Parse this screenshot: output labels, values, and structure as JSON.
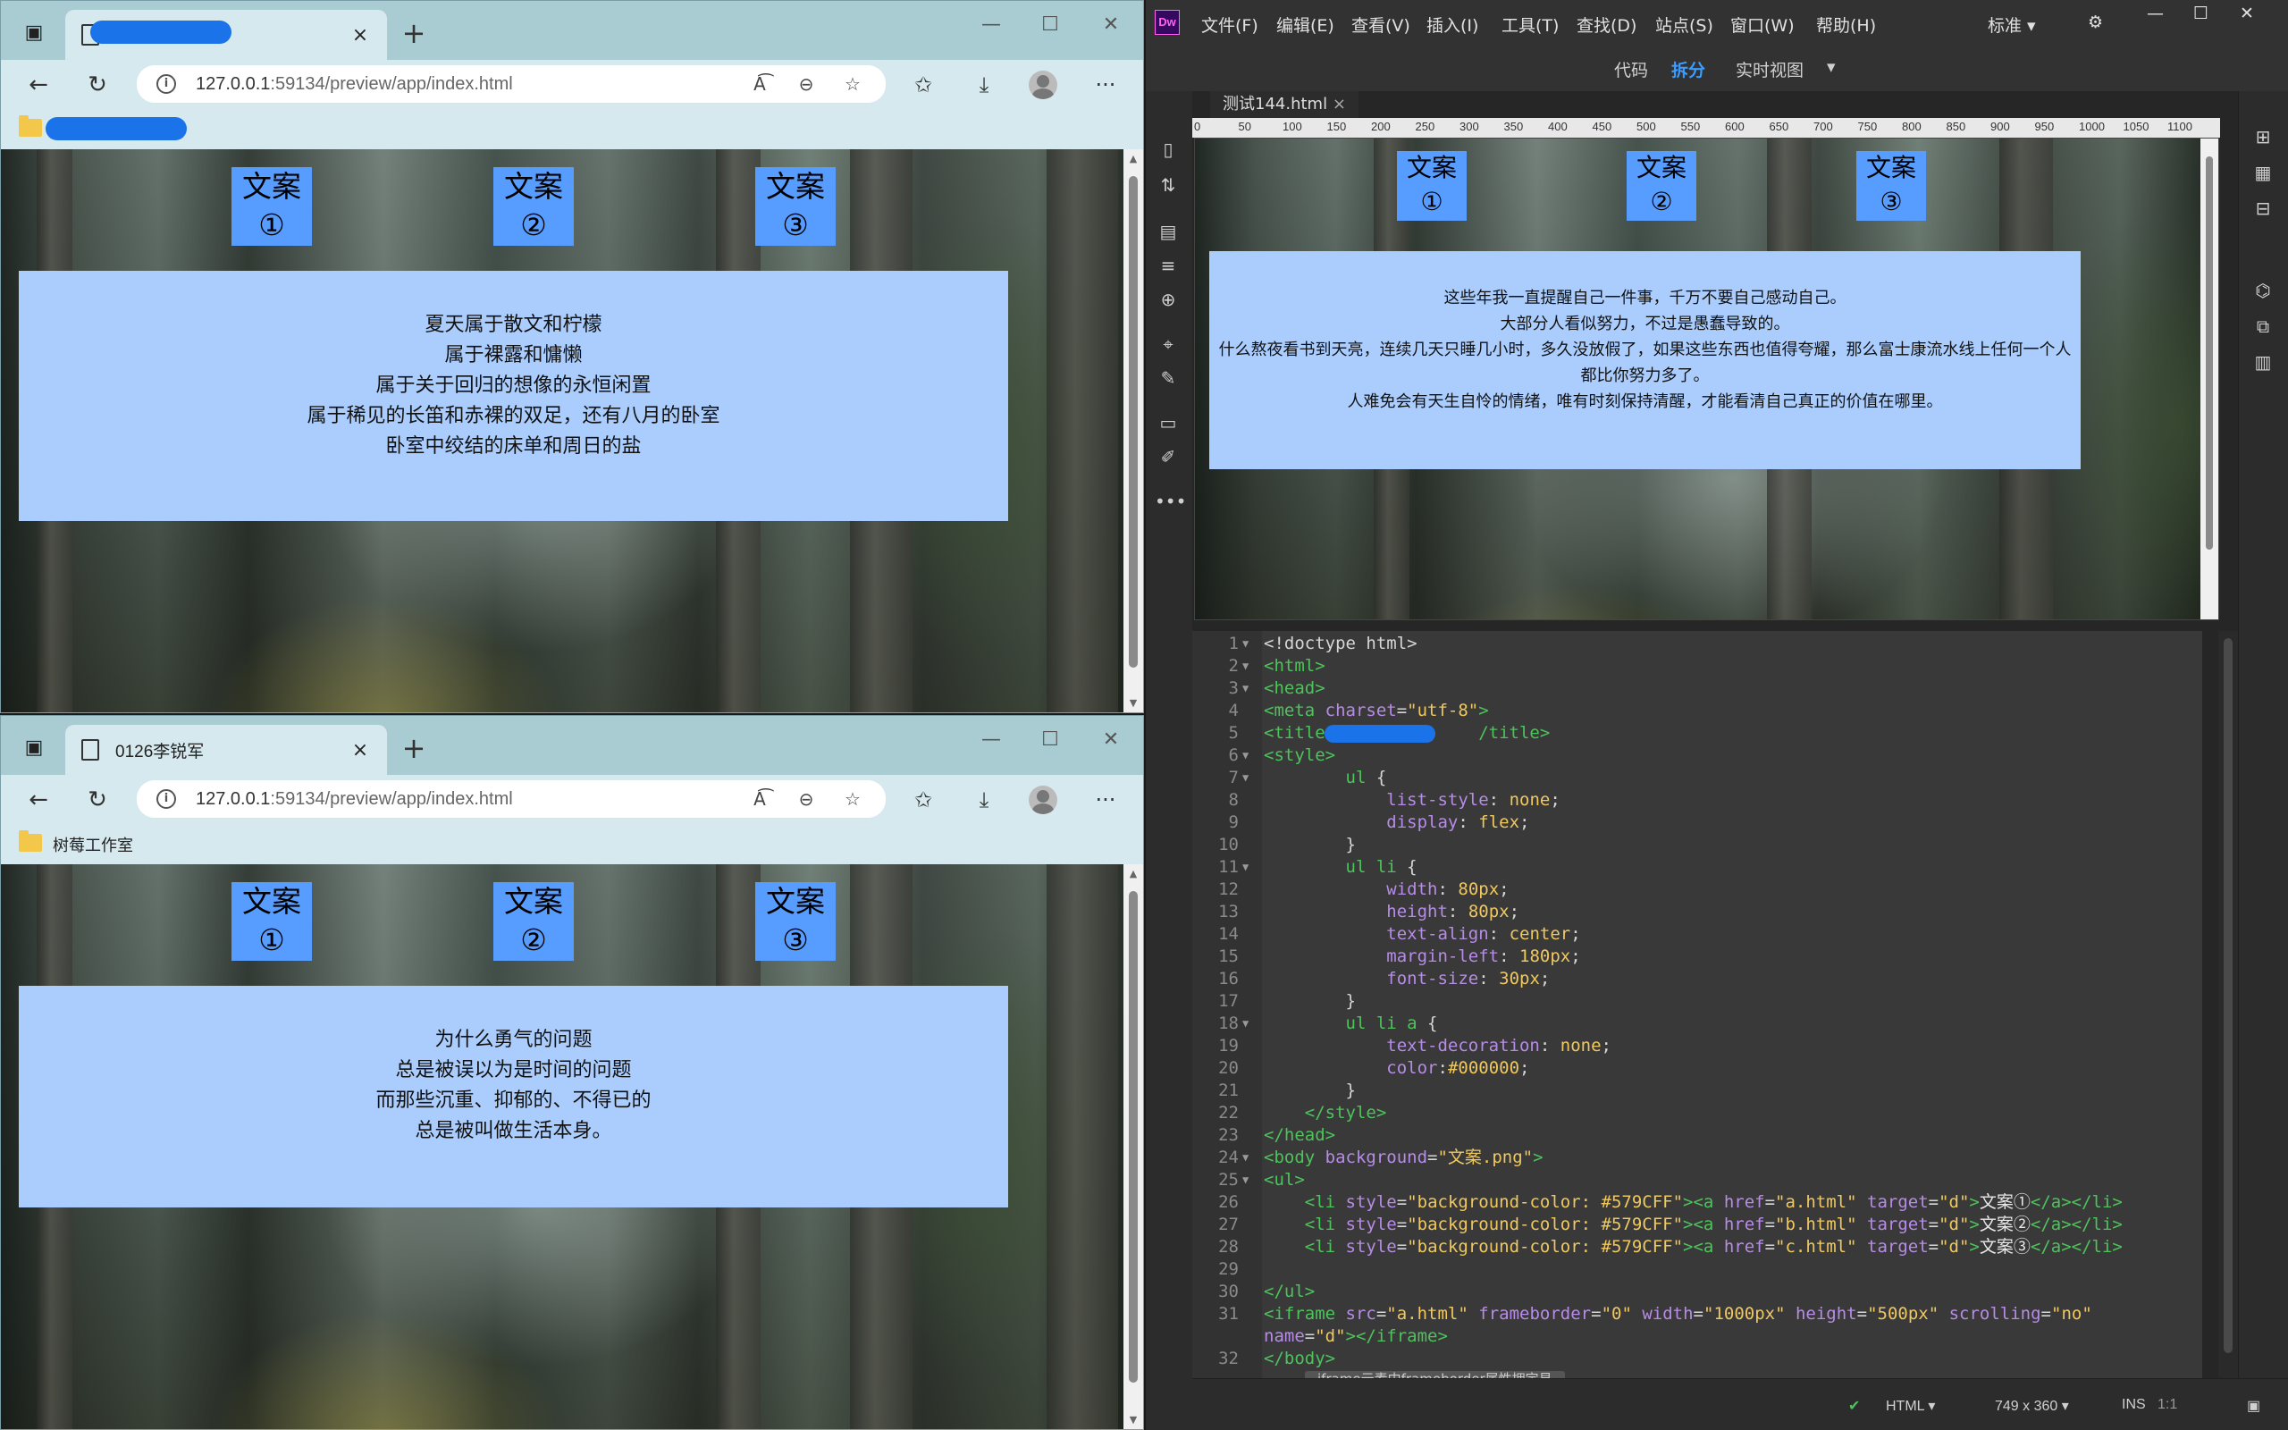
{
  "browser_top": {
    "tab_title": "",
    "url_host": "127.0.0.1",
    "url_path": ":59134/preview/app/index.html",
    "fav_label": "",
    "nav": [
      "文案①",
      "文案②",
      "文案③"
    ],
    "frame_lines": [
      "夏天属于散文和柠檬",
      "属于裸露和慵懒",
      "属于关于回归的想像的永恒闲置",
      "属于稀见的长笛和赤裸的双足，还有八月的卧室",
      "卧室中绞结的床单和周日的盐"
    ]
  },
  "browser_bottom": {
    "tab_title": "0126李锐军",
    "url_host": "127.0.0.1",
    "url_path": ":59134/preview/app/index.html",
    "fav_label": "树莓工作室",
    "nav": [
      "文案①",
      "文案②",
      "文案③"
    ],
    "frame_lines": [
      "为什么勇气的问题",
      "总是被误以为是时间的问题",
      "而那些沉重、抑郁的、不得已的",
      "总是被叫做生活本身。"
    ]
  },
  "dreamweaver": {
    "logo": "Dw",
    "menus": [
      "文件(F)",
      "编辑(E)",
      "查看(V)",
      "插入(I)",
      "工具(T)",
      "查找(D)",
      "站点(S)",
      "窗口(W)",
      "帮助(H)"
    ],
    "workspace": "标准",
    "views": [
      "代码",
      "拆分",
      "实时视图"
    ],
    "active_view": "拆分",
    "doc_tab": "测试144.html",
    "ruler_marks": [
      "0",
      "50",
      "100",
      "150",
      "200",
      "250",
      "300",
      "350",
      "400",
      "450",
      "500",
      "550",
      "600",
      "650",
      "700",
      "750",
      "800",
      "850",
      "900",
      "950",
      "1000",
      "1050",
      "1100"
    ],
    "live_nav": [
      "文案①",
      "文案②",
      "文案③"
    ],
    "live_frame_lines": [
      "这些年我一直提醒自己一件事，千万不要自己感动自己。",
      "大部分人看似努力，不过是愚蠢导致的。",
      "什么熬夜看书到天亮，连续几天只睡几小时，多久没放假了，如果这些东西也值得夸耀，那么富士康流水线上任何一个人都比你努力多了。",
      "人难免会有天生自怜的情绪，唯有时刻保持清醒，才能看清自己真正的价值在哪里。"
    ],
    "status": {
      "doc_type": "HTML",
      "size": "749 x 360",
      "mode": "INS",
      "position": "1:1"
    },
    "tooltip": "iframe元素中frameborder属性拥定見"
  },
  "code_lines": [
    {
      "n": "1",
      "f": "▼",
      "segs": [
        [
          "pn",
          "<!doctype html>"
        ]
      ]
    },
    {
      "n": "2",
      "f": "▼",
      "segs": [
        [
          "tg",
          "<html>"
        ]
      ]
    },
    {
      "n": "3",
      "f": "▼",
      "segs": [
        [
          "tg",
          "<head>"
        ]
      ]
    },
    {
      "n": "4",
      "f": "",
      "segs": [
        [
          "tg",
          "<meta "
        ],
        [
          "at",
          "charset"
        ],
        [
          "pn",
          "="
        ],
        [
          "sv",
          "\"utf-8\""
        ],
        [
          "tg",
          ">"
        ]
      ]
    },
    {
      "n": "5",
      "f": "",
      "segs": [
        [
          "tg",
          "<title"
        ],
        [
          "pn",
          "               "
        ],
        [
          "tg",
          "/title>"
        ]
      ]
    },
    {
      "n": "6",
      "f": "▼",
      "segs": [
        [
          "tg",
          "<style>"
        ]
      ]
    },
    {
      "n": "7",
      "f": "▼",
      "segs": [
        [
          "pn",
          "        "
        ],
        [
          "tg",
          "ul"
        ],
        [
          "pn",
          " {"
        ]
      ]
    },
    {
      "n": "8",
      "f": "",
      "segs": [
        [
          "pn",
          "            "
        ],
        [
          "pr",
          "list-style"
        ],
        [
          "pn",
          ": "
        ],
        [
          "vl",
          "none"
        ],
        [
          "pn",
          ";"
        ]
      ]
    },
    {
      "n": "9",
      "f": "",
      "segs": [
        [
          "pn",
          "            "
        ],
        [
          "pr",
          "display"
        ],
        [
          "pn",
          ": "
        ],
        [
          "vl",
          "flex"
        ],
        [
          "pn",
          ";"
        ]
      ]
    },
    {
      "n": "10",
      "f": "",
      "segs": [
        [
          "pn",
          "        }"
        ]
      ]
    },
    {
      "n": "11",
      "f": "▼",
      "segs": [
        [
          "pn",
          "        "
        ],
        [
          "tg",
          "ul li"
        ],
        [
          "pn",
          " {"
        ]
      ]
    },
    {
      "n": "12",
      "f": "",
      "segs": [
        [
          "pn",
          "            "
        ],
        [
          "pr",
          "width"
        ],
        [
          "pn",
          ": "
        ],
        [
          "vl",
          "80px"
        ],
        [
          "pn",
          ";"
        ]
      ]
    },
    {
      "n": "13",
      "f": "",
      "segs": [
        [
          "pn",
          "            "
        ],
        [
          "pr",
          "height"
        ],
        [
          "pn",
          ": "
        ],
        [
          "vl",
          "80px"
        ],
        [
          "pn",
          ";"
        ]
      ]
    },
    {
      "n": "14",
      "f": "",
      "segs": [
        [
          "pn",
          "            "
        ],
        [
          "pr",
          "text-align"
        ],
        [
          "pn",
          ": "
        ],
        [
          "vl",
          "center"
        ],
        [
          "pn",
          ";"
        ]
      ]
    },
    {
      "n": "15",
      "f": "",
      "segs": [
        [
          "pn",
          "            "
        ],
        [
          "pr",
          "margin-left"
        ],
        [
          "pn",
          ": "
        ],
        [
          "vl",
          "180px"
        ],
        [
          "pn",
          ";"
        ]
      ]
    },
    {
      "n": "16",
      "f": "",
      "segs": [
        [
          "pn",
          "            "
        ],
        [
          "pr",
          "font-size"
        ],
        [
          "pn",
          ": "
        ],
        [
          "vl",
          "30px"
        ],
        [
          "pn",
          ";"
        ]
      ]
    },
    {
      "n": "17",
      "f": "",
      "segs": [
        [
          "pn",
          "        }"
        ]
      ]
    },
    {
      "n": "18",
      "f": "▼",
      "segs": [
        [
          "pn",
          "        "
        ],
        [
          "tg",
          "ul li a"
        ],
        [
          "pn",
          " {"
        ]
      ]
    },
    {
      "n": "19",
      "f": "",
      "segs": [
        [
          "pn",
          "            "
        ],
        [
          "pr",
          "text-decoration"
        ],
        [
          "pn",
          ": "
        ],
        [
          "vl",
          "none"
        ],
        [
          "pn",
          ";"
        ]
      ]
    },
    {
      "n": "20",
      "f": "",
      "segs": [
        [
          "pn",
          "            "
        ],
        [
          "pr",
          "color"
        ],
        [
          "pn",
          ":"
        ],
        [
          "vl",
          "#000000"
        ],
        [
          "pn",
          ";"
        ]
      ]
    },
    {
      "n": "21",
      "f": "",
      "segs": [
        [
          "pn",
          "        }"
        ]
      ]
    },
    {
      "n": "22",
      "f": "",
      "segs": [
        [
          "pn",
          "    "
        ],
        [
          "tg",
          "</style>"
        ]
      ]
    },
    {
      "n": "23",
      "f": "",
      "segs": [
        [
          "tg",
          "</head>"
        ]
      ]
    },
    {
      "n": "24",
      "f": "▼",
      "segs": [
        [
          "tg",
          "<body "
        ],
        [
          "at",
          "background"
        ],
        [
          "pn",
          "="
        ],
        [
          "sv",
          "\"文案.png\""
        ],
        [
          "tg",
          ">"
        ]
      ]
    },
    {
      "n": "25",
      "f": "▼",
      "segs": [
        [
          "tg",
          "<ul>"
        ]
      ]
    },
    {
      "n": "26",
      "f": "",
      "segs": [
        [
          "pn",
          "    "
        ],
        [
          "tg",
          "<li "
        ],
        [
          "at",
          "style"
        ],
        [
          "pn",
          "="
        ],
        [
          "sv",
          "\"background-color: #579CFF\""
        ],
        [
          "tg",
          "><a "
        ],
        [
          "at",
          "href"
        ],
        [
          "pn",
          "="
        ],
        [
          "sv",
          "\"a.html\""
        ],
        [
          "pn",
          " "
        ],
        [
          "at",
          "target"
        ],
        [
          "pn",
          "="
        ],
        [
          "sv",
          "\"d\""
        ],
        [
          "tg",
          ">"
        ],
        [
          "ct",
          "文案①"
        ],
        [
          "tg",
          "</a></li>"
        ]
      ]
    },
    {
      "n": "27",
      "f": "",
      "segs": [
        [
          "pn",
          "    "
        ],
        [
          "tg",
          "<li "
        ],
        [
          "at",
          "style"
        ],
        [
          "pn",
          "="
        ],
        [
          "sv",
          "\"background-color: #579CFF\""
        ],
        [
          "tg",
          "><a "
        ],
        [
          "at",
          "href"
        ],
        [
          "pn",
          "="
        ],
        [
          "sv",
          "\"b.html\""
        ],
        [
          "pn",
          " "
        ],
        [
          "at",
          "target"
        ],
        [
          "pn",
          "="
        ],
        [
          "sv",
          "\"d\""
        ],
        [
          "tg",
          ">"
        ],
        [
          "ct",
          "文案②"
        ],
        [
          "tg",
          "</a></li>"
        ]
      ]
    },
    {
      "n": "28",
      "f": "",
      "segs": [
        [
          "pn",
          "    "
        ],
        [
          "tg",
          "<li "
        ],
        [
          "at",
          "style"
        ],
        [
          "pn",
          "="
        ],
        [
          "sv",
          "\"background-color: #579CFF\""
        ],
        [
          "tg",
          "><a "
        ],
        [
          "at",
          "href"
        ],
        [
          "pn",
          "="
        ],
        [
          "sv",
          "\"c.html\""
        ],
        [
          "pn",
          " "
        ],
        [
          "at",
          "target"
        ],
        [
          "pn",
          "="
        ],
        [
          "sv",
          "\"d\""
        ],
        [
          "tg",
          ">"
        ],
        [
          "ct",
          "文案③"
        ],
        [
          "tg",
          "</a></li>"
        ]
      ]
    },
    {
      "n": "29",
      "f": "",
      "segs": []
    },
    {
      "n": "30",
      "f": "",
      "segs": [
        [
          "tg",
          "</ul>"
        ]
      ]
    },
    {
      "n": "31",
      "f": "",
      "segs": [
        [
          "tg",
          "<iframe "
        ],
        [
          "at",
          "src"
        ],
        [
          "pn",
          "="
        ],
        [
          "sv",
          "\"a.html\""
        ],
        [
          "pn",
          " "
        ],
        [
          "at",
          "frameborder"
        ],
        [
          "pn",
          "="
        ],
        [
          "sv",
          "\"0\""
        ],
        [
          "pn",
          " "
        ],
        [
          "at",
          "width"
        ],
        [
          "pn",
          "="
        ],
        [
          "sv",
          "\"1000px\""
        ],
        [
          "pn",
          " "
        ],
        [
          "at",
          "height"
        ],
        [
          "pn",
          "="
        ],
        [
          "sv",
          "\"500px\""
        ],
        [
          "pn",
          " "
        ],
        [
          "at",
          "scrolling"
        ],
        [
          "pn",
          "="
        ],
        [
          "sv",
          "\"no\""
        ]
      ]
    },
    {
      "n": "",
      "f": "",
      "segs": [
        [
          "at",
          "name"
        ],
        [
          "pn",
          "="
        ],
        [
          "sv",
          "\"d\""
        ],
        [
          "tg",
          "></iframe>"
        ]
      ]
    },
    {
      "n": "32",
      "f": "",
      "segs": [
        [
          "tg",
          "</body>"
        ]
      ]
    }
  ]
}
